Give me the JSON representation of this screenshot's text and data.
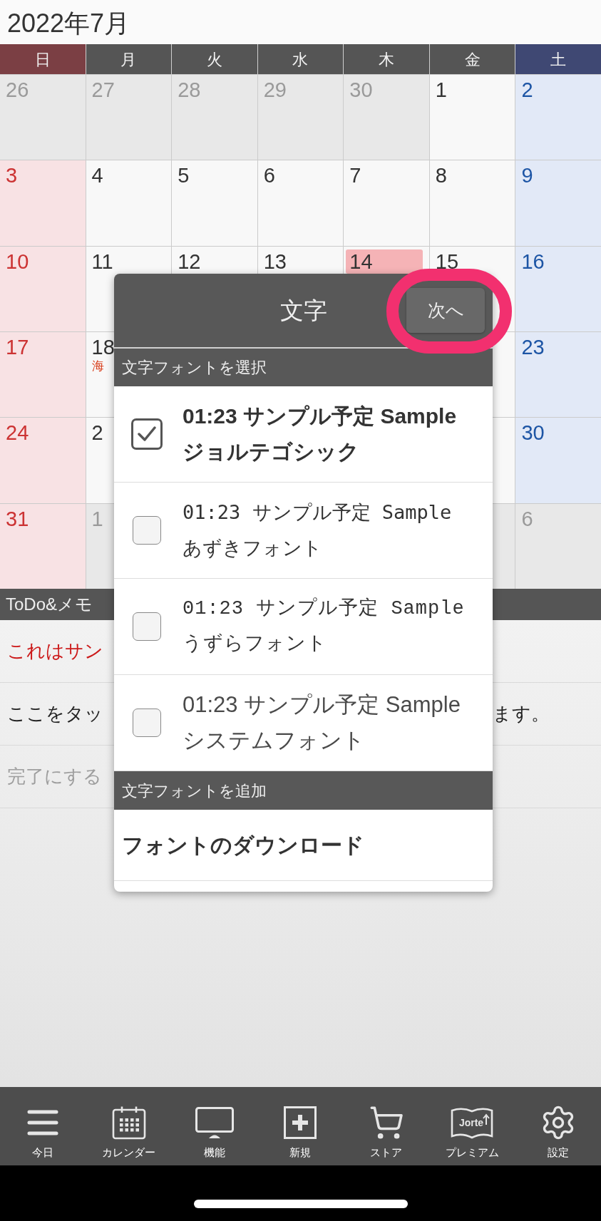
{
  "calendar": {
    "title": "2022年7月",
    "weekdays": [
      "日",
      "月",
      "火",
      "水",
      "木",
      "金",
      "土"
    ],
    "weeks": [
      {
        "sun": {
          "day": "26",
          "other_month": true,
          "today": false
        },
        "mon": {
          "day": "27",
          "other_month": true,
          "today": false
        },
        "tue": {
          "day": "28",
          "other_month": true,
          "today": false
        },
        "wed": {
          "day": "29",
          "other_month": true,
          "today": false
        },
        "thu": {
          "day": "30",
          "other_month": true,
          "today": false
        },
        "fri": {
          "day": "1",
          "other_month": false,
          "today": false
        },
        "sat": {
          "day": "2",
          "other_month": false,
          "today": false
        }
      },
      {
        "sun": {
          "day": "3",
          "other_month": false,
          "today": false
        },
        "mon": {
          "day": "4",
          "other_month": false,
          "today": false
        },
        "tue": {
          "day": "5",
          "other_month": false,
          "today": false
        },
        "wed": {
          "day": "6",
          "other_month": false,
          "today": false
        },
        "thu": {
          "day": "7",
          "other_month": false,
          "today": false
        },
        "fri": {
          "day": "8",
          "other_month": false,
          "today": false
        },
        "sat": {
          "day": "9",
          "other_month": false,
          "today": false
        }
      },
      {
        "sun": {
          "day": "10",
          "other_month": false,
          "today": false
        },
        "mon": {
          "day": "11",
          "other_month": false,
          "today": false
        },
        "tue": {
          "day": "12",
          "other_month": false,
          "today": false
        },
        "wed": {
          "day": "13",
          "other_month": false,
          "today": false
        },
        "thu": {
          "day": "14",
          "other_month": false,
          "today": true
        },
        "fri": {
          "day": "15",
          "other_month": false,
          "today": false
        },
        "sat": {
          "day": "16",
          "other_month": false,
          "today": false
        }
      },
      {
        "sun": {
          "day": "17",
          "other_month": false,
          "today": false
        },
        "mon": {
          "day": "18",
          "label": "海",
          "other_month": false,
          "today": false
        },
        "fri": {
          "other_month": false
        },
        "sat": {
          "day": "23",
          "other_month": false,
          "today": false
        }
      },
      {
        "sun": {
          "day": "24",
          "other_month": false,
          "today": false
        },
        "mon": {
          "day": "2",
          "other_month": false,
          "today": false
        },
        "fri": {
          "other_month": false
        },
        "sat": {
          "day": "30",
          "other_month": false,
          "today": false
        }
      },
      {
        "sun": {
          "day": "31",
          "other_month": false,
          "today": false
        },
        "mon": {
          "day": "1",
          "other_month": true,
          "today": false
        },
        "fri": {
          "other_month": true
        },
        "sat": {
          "day": "6",
          "other_month": true,
          "today": false
        }
      }
    ]
  },
  "todo": {
    "title": "ToDo&メモ",
    "items": [
      {
        "text": "これはサン",
        "color": "#cc1a1a"
      },
      {
        "text": "ここをタッ",
        "text_end": "ます。",
        "color": "#222222"
      },
      {
        "text": "完了にする",
        "color": "#9e9e9e"
      }
    ]
  },
  "dialog": {
    "title": "文字",
    "next_button": {
      "label": "次へ",
      "highlighted": true
    },
    "font_section": {
      "heading": "文字フォントを選択",
      "options": [
        {
          "sample": "01:23 サンプル予定 Sample",
          "name": "ジョルテゴシック",
          "kind": "gothic",
          "checked": true
        },
        {
          "sample": "01:23 サンプル予定 Sample",
          "name": "あずきフォント",
          "kind": "azuki",
          "checked": false
        },
        {
          "sample": "01:23 サンプル予定 Sample",
          "name": "うずらフォント",
          "kind": "uzura",
          "checked": false
        },
        {
          "sample": "01:23 サンプル予定 Sample",
          "name": "システムフォント",
          "kind": "system",
          "checked": false
        }
      ]
    },
    "add_section": {
      "heading": "文字フォントを追加",
      "items": [
        "フォントのダウンロード"
      ]
    }
  },
  "nav": [
    {
      "label": "今日"
    },
    {
      "label": "カレンダー"
    },
    {
      "label": "機能"
    },
    {
      "label": "新規"
    },
    {
      "label": "ストア"
    },
    {
      "label": "プレミアム",
      "icon_text": "Jorte"
    },
    {
      "label": "設定"
    }
  ]
}
